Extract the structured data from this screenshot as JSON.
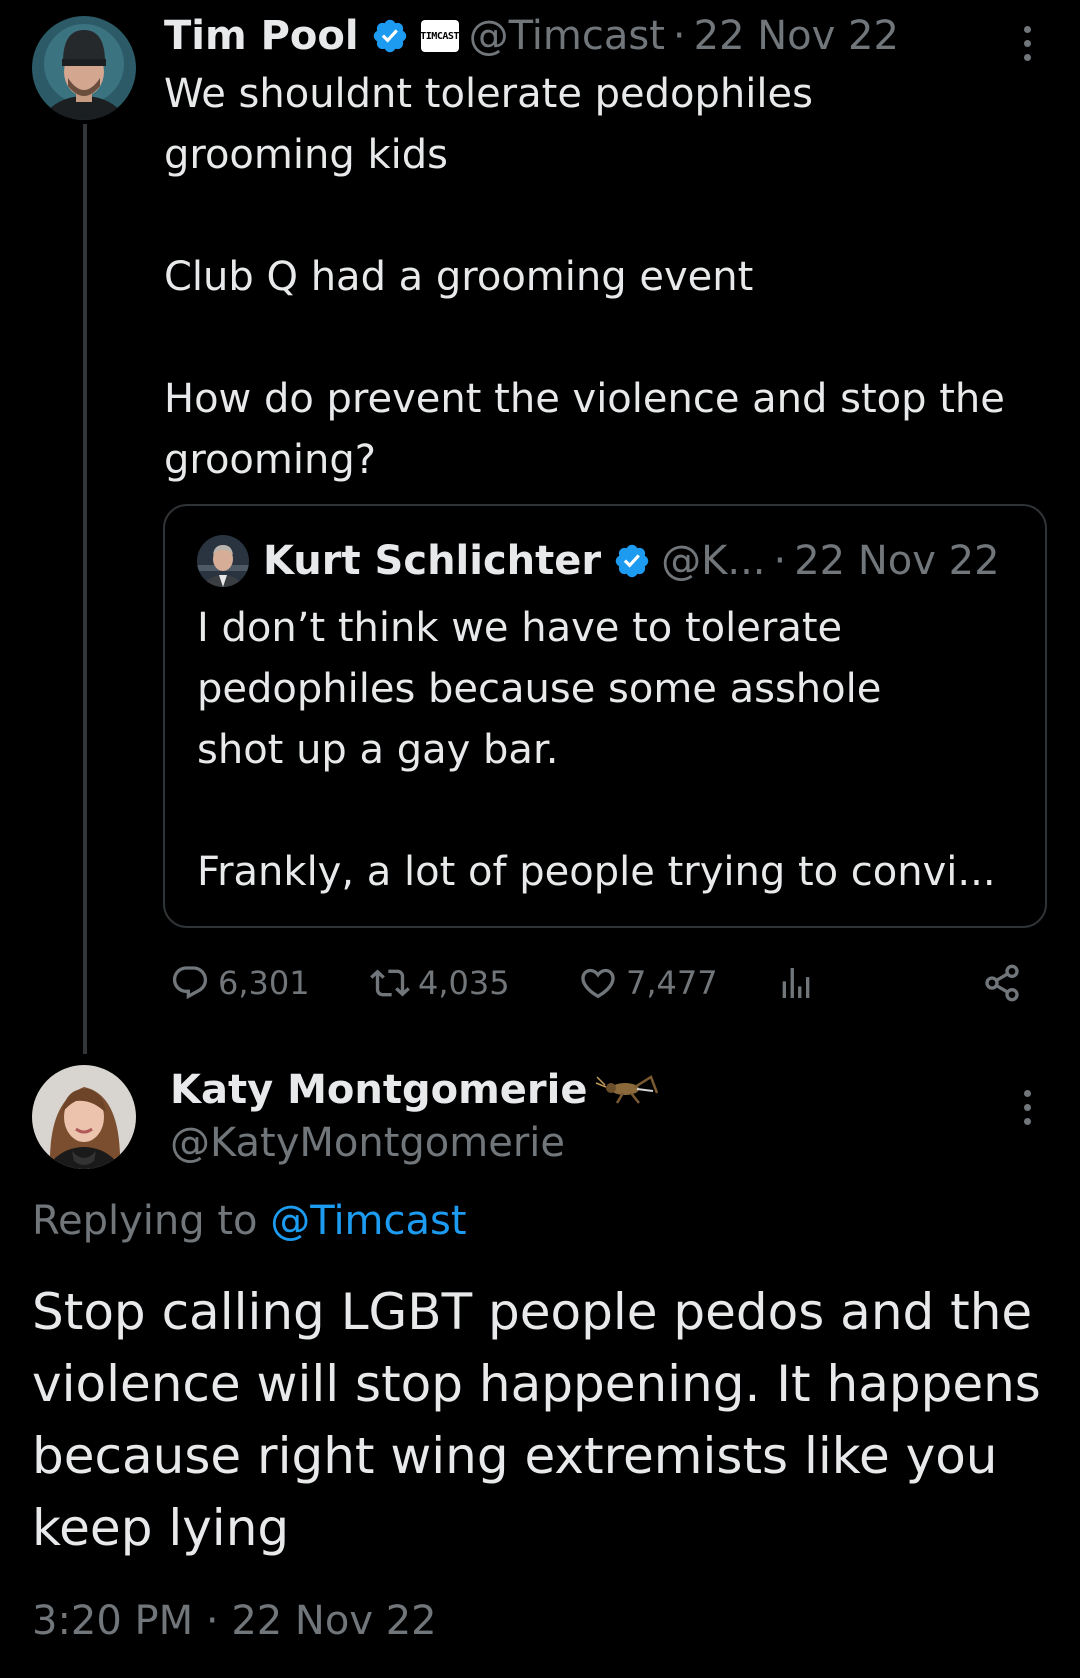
{
  "tweet": {
    "author_name": "Tim Pool",
    "affiliate_badge": "TIMCAST",
    "handle": "@Timcast",
    "separator": "·",
    "date": "22 Nov 22",
    "text": "We shouldnt tolerate pedophiles\ngrooming kids\n\nClub Q had a grooming event\n\nHow do prevent the violence and stop the\ngrooming?",
    "quote": {
      "author_name": "Kurt Schlichter",
      "handle": "@K...",
      "separator": "·",
      "date": "22 Nov 22",
      "text": "I don’t think we have to tolerate\npedophiles because some asshole\nshot up a gay bar.\n\nFrankly, a lot of people trying to convi..."
    },
    "stats": {
      "replies": "6,301",
      "retweets": "4,035",
      "likes": "7,477"
    }
  },
  "reply": {
    "author_name": "Katy Montgomerie",
    "name_emoji": "cricket-icon",
    "handle": "@KatyMontgomerie",
    "replying_prefix": "Replying to ",
    "replying_mention": "@Timcast",
    "text": "Stop calling LGBT people pedos and the violence will stop happening. It happens because right wing extremists like you keep lying",
    "timestamp": "3:20 PM · 22 Nov 22"
  },
  "colors": {
    "background": "#000000",
    "text": "#e7e9ea",
    "muted": "#71767b",
    "accent": "#1d9bf0",
    "border": "#2f3336"
  },
  "icons": [
    "verified-badge-icon",
    "more-icon",
    "reply-icon",
    "retweet-icon",
    "like-icon",
    "views-icon",
    "share-icon",
    "cricket-icon"
  ]
}
